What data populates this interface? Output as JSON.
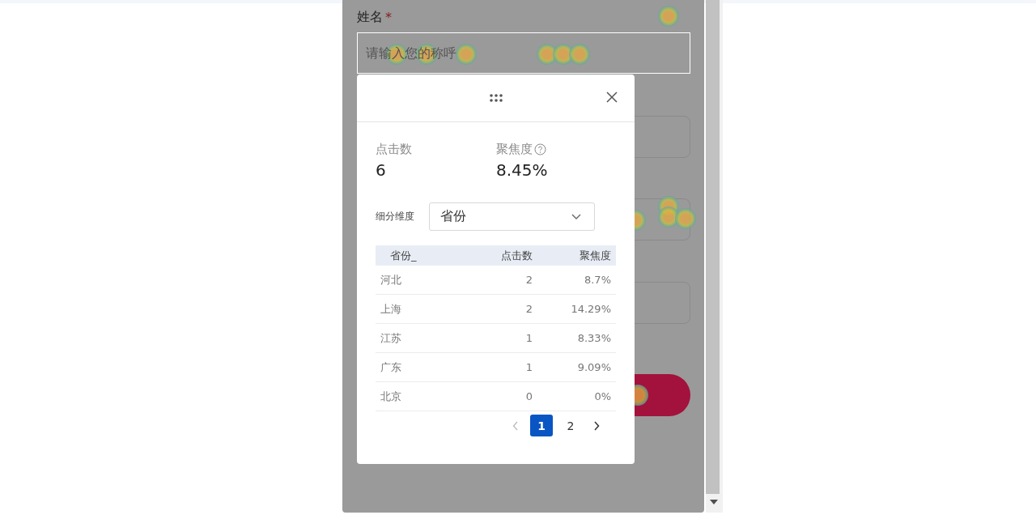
{
  "form": {
    "name_label": "姓名",
    "required_mark": "*",
    "name_placeholder": "请输入您的称呼"
  },
  "popup": {
    "stats": [
      {
        "label": "点击数",
        "value": "6",
        "help": false
      },
      {
        "label": "聚焦度",
        "value": "8.45%",
        "help": true
      }
    ],
    "dimension": {
      "label": "细分维度",
      "value": "省份"
    },
    "table": {
      "columns": [
        "省份_",
        "点击数",
        "聚焦度"
      ],
      "rows": [
        [
          "河北",
          "2",
          "8.7%"
        ],
        [
          "上海",
          "2",
          "14.29%"
        ],
        [
          "江苏",
          "1",
          "8.33%"
        ],
        [
          "广东",
          "1",
          "9.09%"
        ],
        [
          "北京",
          "0",
          "0%"
        ]
      ]
    },
    "pagination": {
      "prev_disabled": true,
      "next_disabled": false,
      "pages": [
        {
          "label": "1",
          "selected": true
        },
        {
          "label": "2",
          "selected": false
        }
      ]
    }
  }
}
